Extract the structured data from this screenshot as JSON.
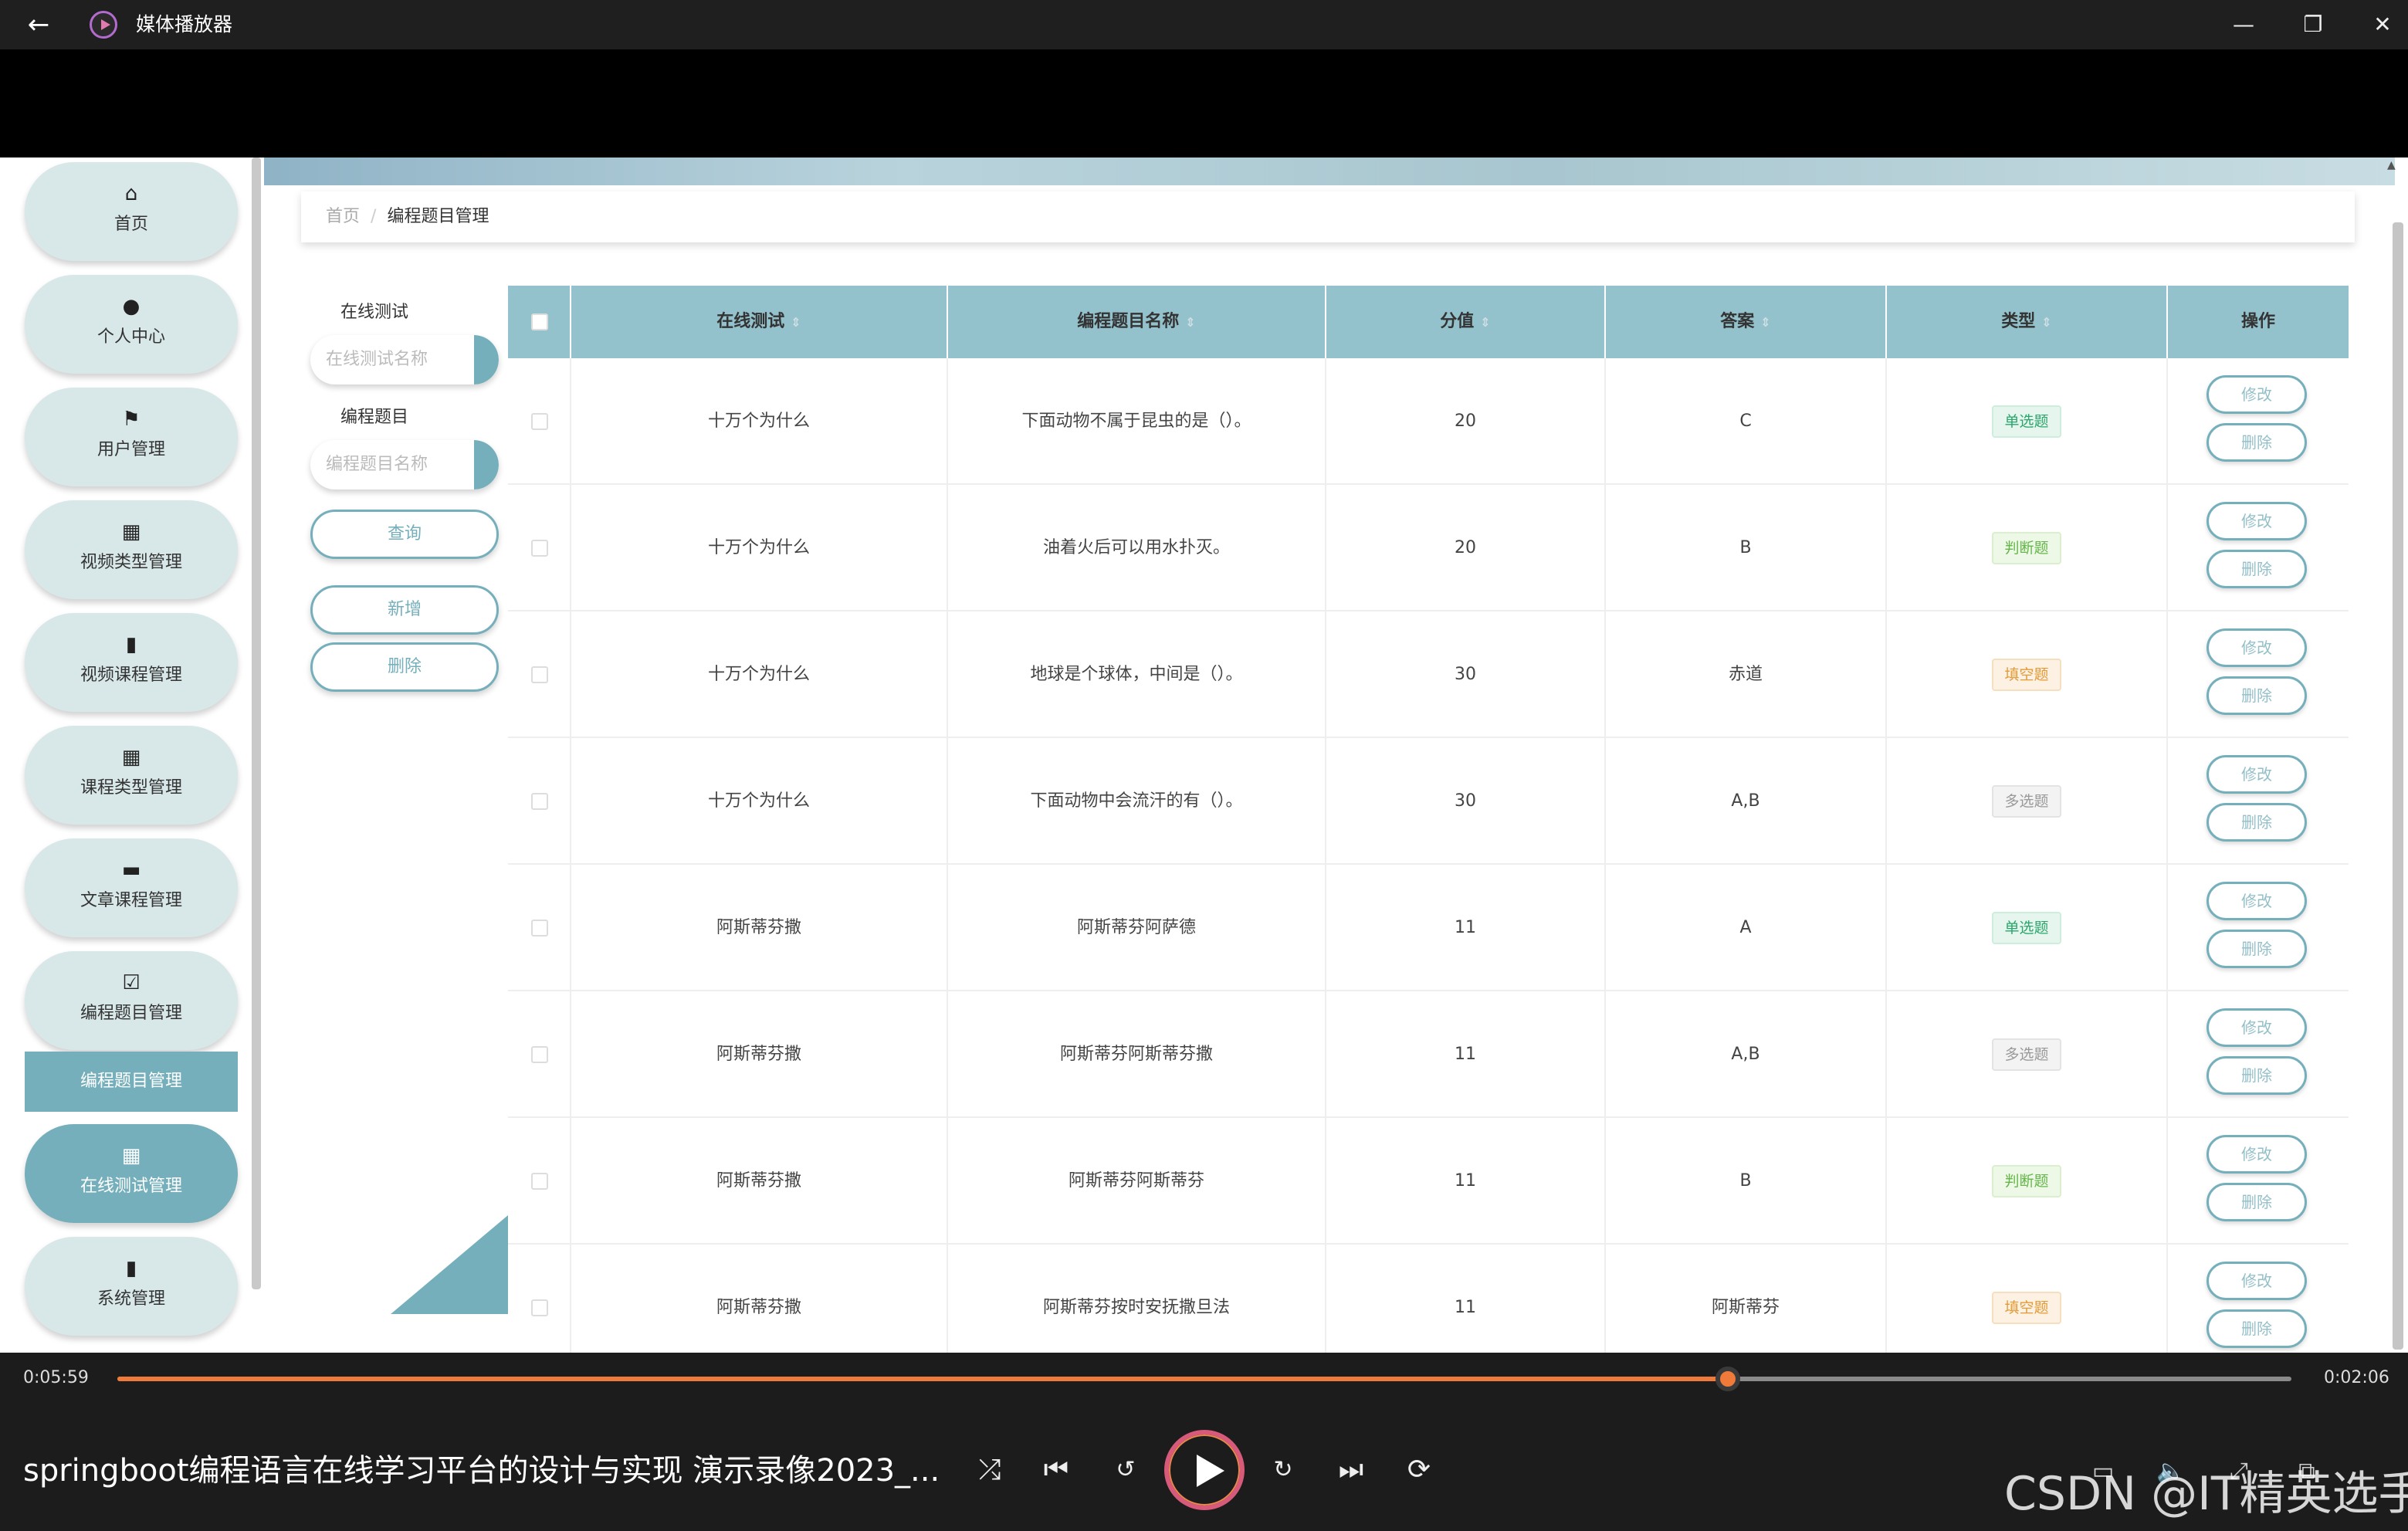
{
  "app": {
    "title": "媒体播放器",
    "back_icon": "arrow-left-icon",
    "window_controls": [
      "minimize-icon",
      "restore-icon",
      "close-icon"
    ]
  },
  "sidebar": {
    "items": [
      {
        "label": "首页",
        "icon": "home-icon",
        "glyph": "⌂"
      },
      {
        "label": "个人中心",
        "icon": "user-icon",
        "glyph": "●"
      },
      {
        "label": "用户管理",
        "icon": "flag-icon",
        "glyph": "⚑"
      },
      {
        "label": "视频类型管理",
        "icon": "grid-icon",
        "glyph": "▦"
      },
      {
        "label": "视频课程管理",
        "icon": "book-icon",
        "glyph": "▮"
      },
      {
        "label": "课程类型管理",
        "icon": "apps-icon",
        "glyph": "▦"
      },
      {
        "label": "文章课程管理",
        "icon": "briefcase-icon",
        "glyph": "▬"
      },
      {
        "label": "编程题目管理",
        "icon": "clipboard-check-icon",
        "glyph": "☑"
      },
      {
        "label": "在线测试管理",
        "icon": "apps-icon",
        "glyph": "▦"
      },
      {
        "label": "系统管理",
        "icon": "bar-chart-icon",
        "glyph": "▮"
      }
    ],
    "submenu_label": "编程题目管理"
  },
  "breadcrumb": {
    "home": "首页",
    "separator": "/",
    "current": "编程题目管理"
  },
  "search": {
    "test_label": "在线测试",
    "test_placeholder": "在线测试名称",
    "question_label": "编程题目",
    "question_placeholder": "编程题目名称",
    "query_button": "查询",
    "add_button": "新增",
    "delete_button": "删除"
  },
  "table": {
    "columns": [
      "在线测试",
      "编程题目名称",
      "分值",
      "答案",
      "类型",
      "操作"
    ],
    "edit_label": "修改",
    "delete_label": "删除",
    "rows": [
      {
        "test": "十万个为什么",
        "name": "下面动物不属于昆虫的是（）。",
        "score": "20",
        "answer": "C",
        "type": "单选题",
        "type_class": "single"
      },
      {
        "test": "十万个为什么",
        "name": "油着火后可以用水扑灭。",
        "score": "20",
        "answer": "B",
        "type": "判断题",
        "type_class": "judge"
      },
      {
        "test": "十万个为什么",
        "name": "地球是个球体，中间是（）。",
        "score": "30",
        "answer": "赤道",
        "type": "填空题",
        "type_class": "fill"
      },
      {
        "test": "十万个为什么",
        "name": "下面动物中会流汗的有（）。",
        "score": "30",
        "answer": "A,B",
        "type": "多选题",
        "type_class": "multi"
      },
      {
        "test": "阿斯蒂芬撒",
        "name": "阿斯蒂芬阿萨德",
        "score": "11",
        "answer": "A",
        "type": "单选题",
        "type_class": "single"
      },
      {
        "test": "阿斯蒂芬撒",
        "name": "阿斯蒂芬阿斯蒂芬撒",
        "score": "11",
        "answer": "A,B",
        "type": "多选题",
        "type_class": "multi"
      },
      {
        "test": "阿斯蒂芬撒",
        "name": "阿斯蒂芬阿斯蒂芬",
        "score": "11",
        "answer": "B",
        "type": "判断题",
        "type_class": "judge"
      },
      {
        "test": "阿斯蒂芬撒",
        "name": "阿斯蒂芬按时安抚撒旦法",
        "score": "11",
        "answer": "阿斯蒂芬",
        "type": "填空题",
        "type_class": "fill"
      }
    ]
  },
  "player": {
    "elapsed": "0:05:59",
    "remaining": "0:02:06",
    "progress": 0.7407,
    "video_title": "springboot编程语言在线学习平台的设计与实现 演示录像2023_...",
    "watermark": "CSDN @IT精英选手",
    "controls": [
      "shuffle-icon",
      "previous-icon",
      "rewind-10-icon",
      "play-icon",
      "forward-30-icon",
      "next-icon",
      "repeat-icon"
    ],
    "right_controls": [
      "subtitles-icon",
      "volume-icon",
      "fullscreen-icon",
      "mini-player-icon"
    ],
    "accent": "#f07a3a"
  },
  "colors": {
    "theme": "#75afbb",
    "header": "#93c2cc",
    "menu": "#d8e7e8"
  }
}
